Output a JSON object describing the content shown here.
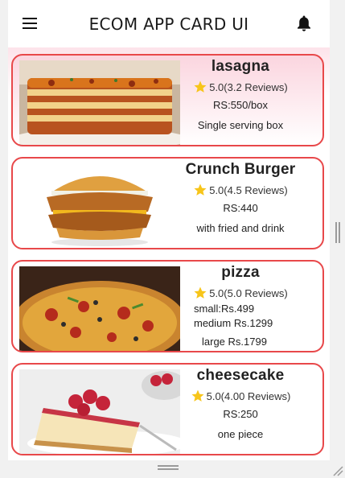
{
  "app": {
    "title": "ECOM APP CARD UI"
  },
  "icons": {
    "menu": "menu-icon",
    "bell": "bell-icon",
    "star": "star-icon"
  },
  "colors": {
    "card_border": "#e8484a",
    "star": "#f7c51a",
    "header_tint": "#fbd5df"
  },
  "products": [
    {
      "name": "lasagna",
      "rating": "5.0(3.2 Reviews)",
      "lines": [
        "RS:550/box",
        "Single serving box"
      ]
    },
    {
      "name": "Crunch Burger",
      "rating": "5.0(4.5 Reviews)",
      "lines": [
        "RS:440",
        "with fried and drink"
      ]
    },
    {
      "name": "pizza",
      "rating": "5.0(5.0 Reviews)",
      "lines": [
        "small:Rs.499",
        "medium Rs.1299",
        "large Rs.1799"
      ]
    },
    {
      "name": "cheesecake",
      "rating": "5.0(4.00 Reviews)",
      "lines": [
        "RS:250",
        "one piece"
      ]
    }
  ]
}
